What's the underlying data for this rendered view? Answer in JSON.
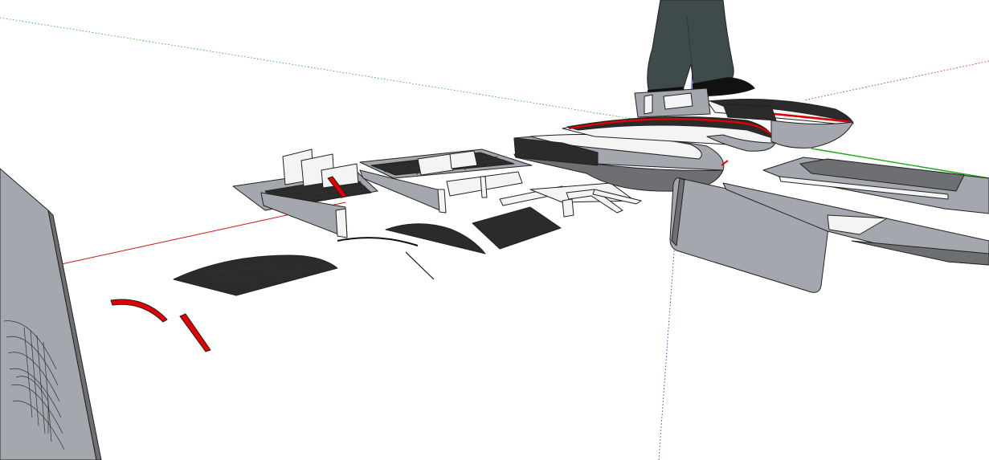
{
  "app": {
    "type": "3d-modeling-viewport"
  },
  "scene": {
    "background": "#ffffff",
    "axes": {
      "red": "#c81414",
      "green": "#1aa81a",
      "blue": "#1a1acc"
    },
    "materials": {
      "dark_face": "#2b2b2b",
      "mid_face": "#6e6f72",
      "light_face": "#a4a7ad",
      "white_face": "#f4f4f4",
      "accent_red": "#e00000",
      "pants": "#3f4a4c",
      "shoe": "#111111"
    },
    "objects": [
      {
        "name": "large-vertical-panel-left"
      },
      {
        "name": "red-curved-strip"
      },
      {
        "name": "red-short-strip"
      },
      {
        "name": "curved-dark-wing-panel"
      },
      {
        "name": "thin-arc-piece"
      },
      {
        "name": "thin-diagonal-line"
      },
      {
        "name": "dark-fin-panel"
      },
      {
        "name": "dark-square-panel"
      },
      {
        "name": "gridded-deck-assembly-left"
      },
      {
        "name": "gridded-deck-assembly-right"
      },
      {
        "name": "white-frame-brackets"
      },
      {
        "name": "hull-pontoon-front"
      },
      {
        "name": "hull-pontoon-rear"
      },
      {
        "name": "standing-person-figure"
      },
      {
        "name": "gray-rounded-panel-right"
      },
      {
        "name": "long-rail-plate-right"
      }
    ]
  }
}
